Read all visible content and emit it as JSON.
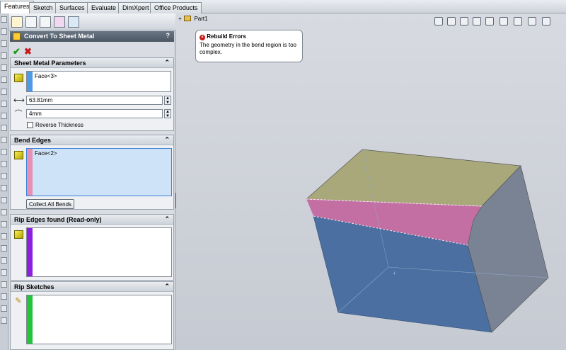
{
  "tabs": [
    {
      "label": "Features",
      "active": true
    },
    {
      "label": "Sketch",
      "active": false
    },
    {
      "label": "Surfaces",
      "active": false
    },
    {
      "label": "Evaluate",
      "active": false
    },
    {
      "label": "DimXpert",
      "active": false
    },
    {
      "label": "Office Products",
      "active": false
    }
  ],
  "property_manager": {
    "title": "Convert To Sheet Metal",
    "help": "?",
    "ok_icon": "✔",
    "cancel_icon": "✖",
    "sheet_metal_parameters": {
      "heading": "Sheet Metal Parameters",
      "fixed_face": "Face<3>",
      "thickness": "63.81mm",
      "bend_radius": "4mm",
      "reverse_thickness_label": "Reverse Thickness",
      "reverse_thickness_checked": false
    },
    "bend_edges": {
      "heading": "Bend Edges",
      "selection": "Face<2>",
      "collect_button": "Collect All Bends"
    },
    "rip_edges": {
      "heading": "Rip Edges found (Read-only)"
    },
    "rip_sketches": {
      "heading": "Rip Sketches"
    }
  },
  "graphics": {
    "tree_root": "Part1"
  },
  "error_callout": {
    "title": "Rebuild Errors",
    "message": "The geometry in the bend region is too complex."
  },
  "colors": {
    "face_top": "#a8a87a",
    "face_front": "#4a6fa0",
    "face_side": "#7a8394",
    "bend_face": "#c36fa4",
    "bar_blue": "#4f9ae4",
    "bar_pink": "#e590b4",
    "bar_purple": "#8d1fe0",
    "bar_green": "#22c43a"
  }
}
